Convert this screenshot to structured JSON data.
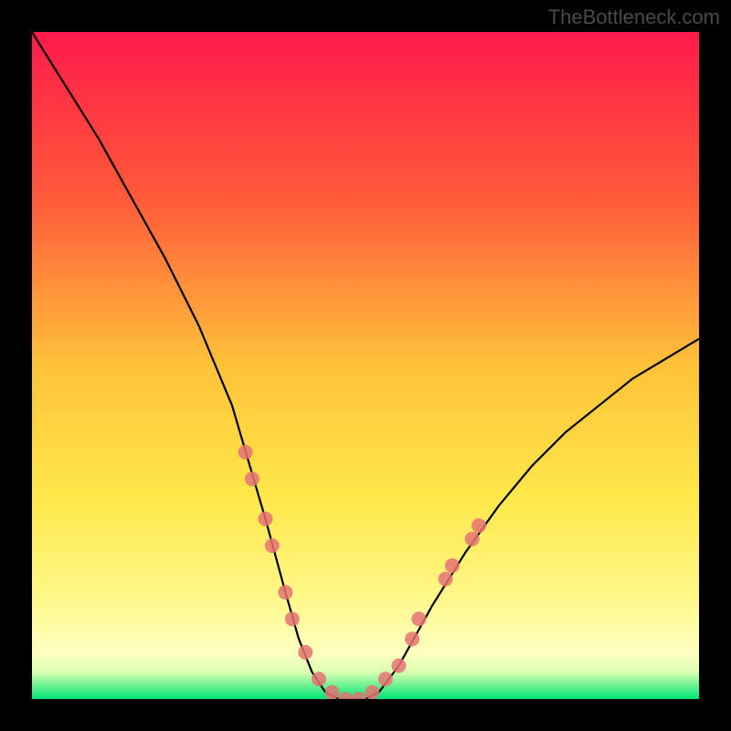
{
  "watermark": "TheBottleneck.com",
  "chart_data": {
    "type": "line",
    "title": "",
    "xlabel": "",
    "ylabel": "",
    "xlim": [
      0,
      100
    ],
    "ylim": [
      0,
      100
    ],
    "background_gradient": {
      "top": "#ff1a4a",
      "mid_upper": "#ff6a3a",
      "mid": "#ffd93a",
      "mid_lower": "#fff88a",
      "bottom": "#00e676"
    },
    "series": [
      {
        "name": "bottleneck-curve",
        "color": "#000000",
        "x": [
          0,
          5,
          10,
          15,
          20,
          25,
          30,
          35,
          38,
          40,
          42,
          44,
          46,
          48,
          50,
          52,
          55,
          60,
          65,
          70,
          75,
          80,
          85,
          90,
          95,
          100
        ],
        "y": [
          100,
          92,
          84,
          75,
          66,
          56,
          44,
          27,
          16,
          9,
          4,
          1,
          0,
          0,
          0,
          1,
          5,
          14,
          22,
          29,
          35,
          40,
          44,
          48,
          51,
          54
        ]
      }
    ],
    "markers": {
      "name": "highlight-points",
      "color": "#e57373",
      "radius": 8,
      "points": [
        {
          "x": 32,
          "y": 37
        },
        {
          "x": 33,
          "y": 33
        },
        {
          "x": 35,
          "y": 27
        },
        {
          "x": 36,
          "y": 23
        },
        {
          "x": 38,
          "y": 16
        },
        {
          "x": 39,
          "y": 12
        },
        {
          "x": 41,
          "y": 7
        },
        {
          "x": 43,
          "y": 3
        },
        {
          "x": 45,
          "y": 1
        },
        {
          "x": 47,
          "y": 0
        },
        {
          "x": 49,
          "y": 0
        },
        {
          "x": 51,
          "y": 1
        },
        {
          "x": 53,
          "y": 3
        },
        {
          "x": 55,
          "y": 5
        },
        {
          "x": 57,
          "y": 9
        },
        {
          "x": 58,
          "y": 12
        },
        {
          "x": 62,
          "y": 18
        },
        {
          "x": 63,
          "y": 20
        },
        {
          "x": 66,
          "y": 24
        },
        {
          "x": 67,
          "y": 26
        }
      ]
    }
  }
}
